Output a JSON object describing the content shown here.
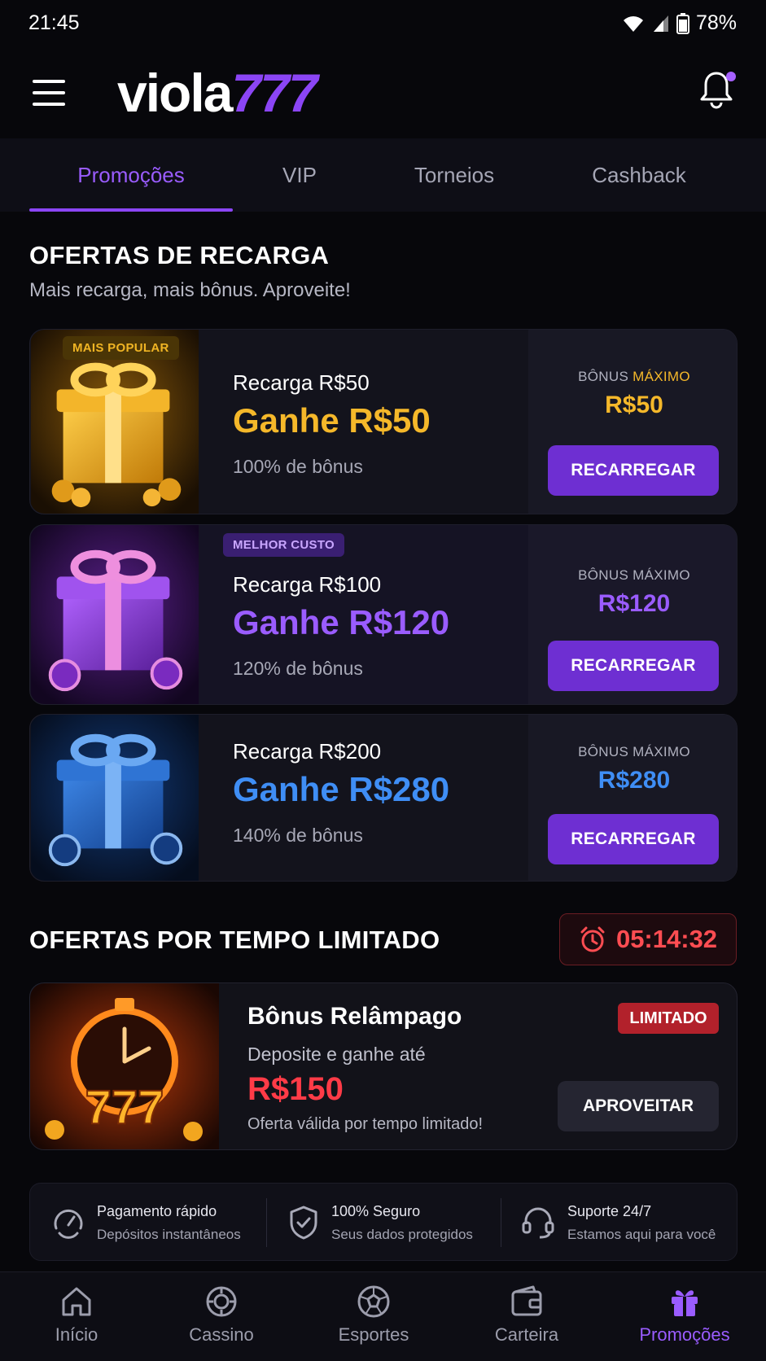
{
  "status": {
    "time": "21:45",
    "battery": "78%"
  },
  "header": {
    "logo_part1": "viola",
    "logo_part2": "777"
  },
  "tabs": [
    {
      "label": "Promoções",
      "active": true
    },
    {
      "label": "VIP"
    },
    {
      "label": "Torneios"
    },
    {
      "label": "Cashback"
    }
  ],
  "recharge_section": {
    "title": "OFERTAS DE RECARGA",
    "subtitle": "Mais recarga, mais bônus. Aproveite!",
    "offers": [
      {
        "badge": "MAIS POPULAR",
        "recharge": "Recarga R$50",
        "gain": "Ganhe R$50",
        "percent": "100% de bônus",
        "bonus_label_1": "BÔNUS",
        "bonus_label_2": "MÁXIMO",
        "bonus_value": "R$50",
        "button": "RECARREGAR",
        "color": "#f5b82a"
      },
      {
        "badge": "MELHOR CUSTO",
        "recharge": "Recarga R$100",
        "gain": "Ganhe R$120",
        "percent": "120% de bônus",
        "bonus_label": "BÔNUS MÁXIMO",
        "bonus_value": "R$120",
        "button": "RECARREGAR",
        "color": "#9a5cff"
      },
      {
        "recharge": "Recarga R$200",
        "gain": "Ganhe R$280",
        "percent": "140% de bônus",
        "bonus_label": "BÔNUS MÁXIMO",
        "bonus_value": "R$280",
        "button": "RECARREGAR",
        "color": "#3f8ef5"
      }
    ]
  },
  "limited_section": {
    "title": "OFERTAS POR TEMPO LIMITADO",
    "timer": "05:14:32",
    "card": {
      "title": "Bônus Relâmpago",
      "subtitle": "Deposite e ganhe até",
      "amount": "R$150",
      "note": "Oferta válida por tempo limitado!",
      "badge": "LIMITADO",
      "button": "APROVEITAR"
    }
  },
  "features": [
    {
      "title": "Pagamento rápido",
      "desc": "Depósitos instantâneos",
      "icon": "speedometer-icon"
    },
    {
      "title": "100% Seguro",
      "desc": "Seus dados protegidos",
      "icon": "shield-icon"
    },
    {
      "title": "Suporte 24/7",
      "desc": "Estamos aqui para você",
      "icon": "headset-icon"
    }
  ],
  "bottom_nav": [
    {
      "label": "Início",
      "icon": "home-icon"
    },
    {
      "label": "Cassino",
      "icon": "casino-chip-icon"
    },
    {
      "label": "Esportes",
      "icon": "soccer-ball-icon"
    },
    {
      "label": "Carteira",
      "icon": "wallet-icon"
    },
    {
      "label": "Promoções",
      "icon": "gift-icon",
      "active": true
    }
  ]
}
